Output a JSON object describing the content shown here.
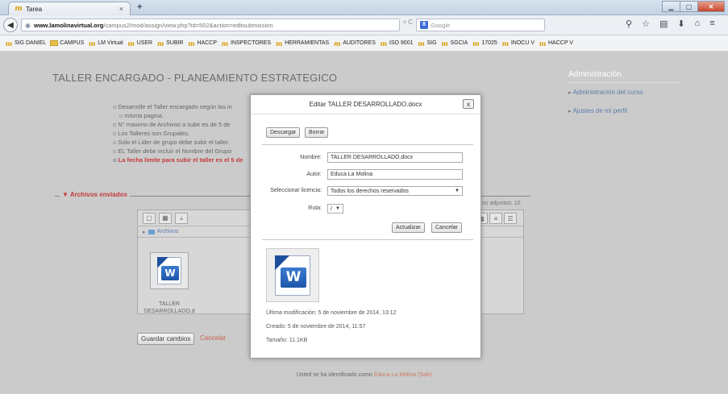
{
  "browser": {
    "tab_title": "Tarea",
    "tab_close": "×",
    "new_tab": "+",
    "url_host": "www.lamolinavirtual.org",
    "url_path": "/campus2/mod/assign/view.php?id=502&action=editsubmission",
    "search_placeholder": "Google",
    "bookmarks": [
      "SIG DANIEL",
      "CAMPUS",
      "LM Virtual",
      "USER",
      "SUBIR",
      "HACCP",
      "INSPECTORES",
      "HERRAMIENTAS",
      "AUDITORES",
      "ISO 9001",
      "SIG",
      "SGCIA",
      "17025",
      "INOCU V",
      "HACCP V"
    ]
  },
  "page": {
    "title": "TALLER ENCARGADO - PLANEAMIENTO ESTRATEGICO",
    "intro": [
      "Desarrolle el Taller encargado según las in",
      "misma pagina.",
      "N° maximo de Archivos a subir es de 5 de",
      "Los Talleres son Grupales.",
      "Solo el Lider de grupo debe subir el taller.",
      "EL Taller debe incluir el Nombre del Grupo",
      "La fecha limite para subir el taller es el 5 de"
    ],
    "legend": "▼ Archivos enviados",
    "max_files": "os adjuntos: 10",
    "path_label": "Archivos",
    "file_name_1": "TALLER",
    "file_name_2": "DESARROLLADO.d",
    "save_label": "Guardar cambios",
    "cancel_label": "Cancelar",
    "footer_text": "Usted se ha identificado como",
    "footer_user": "Educa La Molina",
    "footer_logout": "(Salir)"
  },
  "sidebar": {
    "title": "Administración",
    "items": [
      "Administración del curso",
      "Ajustes de mi perfil"
    ]
  },
  "modal": {
    "title": "Editar TALLER DESARROLLADO.docx",
    "close": "x",
    "download_label": "Descargar",
    "delete_label": "Borrar",
    "name_label": "Nombre:",
    "name_value": "TALLER DESARROLLADO.docx",
    "author_label": "Autor:",
    "author_value": "Educa La Molina",
    "license_label": "Seleccionar licencia:",
    "license_value": "Todos los derechos reservados",
    "path_label": "Ruta:",
    "path_value": "/",
    "update_label": "Actualizar",
    "cancel_label": "Cancelar",
    "last_modified": "Última modificación: 5 de noviembre de 2014, 13:12",
    "created": "Creado: 5 de noviembre de 2014, 11:57",
    "size": "Tamaño: 11.1KB"
  }
}
